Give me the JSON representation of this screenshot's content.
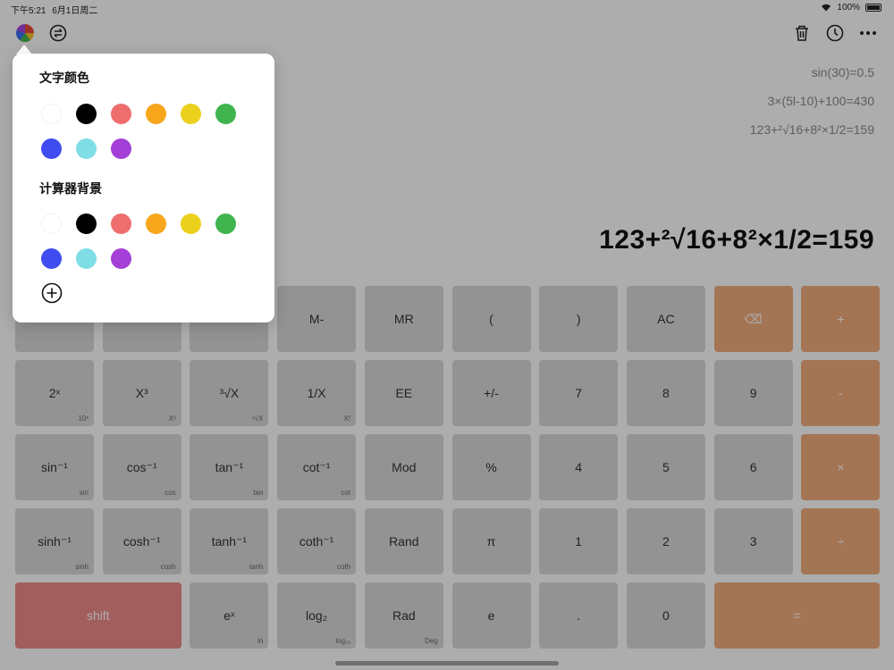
{
  "status_bar": {
    "time": "下午5:21",
    "date": "6月1日周二",
    "battery": "100%"
  },
  "toolbar": {
    "left_icons": [
      "color-wheel-icon",
      "swap-icon"
    ],
    "right_icons": [
      "trash-icon",
      "history-icon",
      "more-icon"
    ]
  },
  "history": [
    "sin(30)=0.5",
    "3×(5l-10)+100=430",
    "123+²√16+8²×1/2=159"
  ],
  "display": {
    "main": "123+²√16+8²×1/2=159"
  },
  "keypad": {
    "rows": [
      [
        {
          "label": "",
          "style": "normal"
        },
        {
          "label": "",
          "style": "normal"
        },
        {
          "label": "",
          "style": "normal"
        },
        {
          "label": "M-",
          "style": "normal"
        },
        {
          "label": "MR",
          "style": "normal"
        },
        {
          "label": "(",
          "style": "normal"
        },
        {
          "label": ")",
          "style": "normal"
        },
        {
          "label": "AC",
          "style": "normal"
        },
        {
          "label": "⌫",
          "style": "orange"
        },
        {
          "label": "+",
          "style": "orange"
        }
      ],
      [
        {
          "label": "2ˣ",
          "sub": "10ˣ"
        },
        {
          "label": "X³",
          "sub": "Xʸ"
        },
        {
          "label": "³√X",
          "sub": "ʸ√X"
        },
        {
          "label": "1/X",
          "sub": "X!"
        },
        {
          "label": "EE"
        },
        {
          "label": "+/-"
        },
        {
          "label": "7"
        },
        {
          "label": "8"
        },
        {
          "label": "9"
        },
        {
          "label": "-",
          "style": "orange"
        }
      ],
      [
        {
          "label": "sin⁻¹",
          "sub": "sin"
        },
        {
          "label": "cos⁻¹",
          "sub": "cos"
        },
        {
          "label": "tan⁻¹",
          "sub": "tan"
        },
        {
          "label": "cot⁻¹",
          "sub": "cot"
        },
        {
          "label": "Mod"
        },
        {
          "label": "%"
        },
        {
          "label": "4"
        },
        {
          "label": "5"
        },
        {
          "label": "6"
        },
        {
          "label": "×",
          "style": "orange"
        }
      ],
      [
        {
          "label": "sinh⁻¹",
          "sub": "sinh"
        },
        {
          "label": "cosh⁻¹",
          "sub": "cosh"
        },
        {
          "label": "tanh⁻¹",
          "sub": "tanh"
        },
        {
          "label": "coth⁻¹",
          "sub": "coth"
        },
        {
          "label": "Rand"
        },
        {
          "label": "π"
        },
        {
          "label": "1"
        },
        {
          "label": "2"
        },
        {
          "label": "3"
        },
        {
          "label": "÷",
          "style": "orange"
        }
      ],
      [
        {
          "label": "shift",
          "style": "red",
          "span": 2
        },
        {
          "label": "eˣ",
          "sub": "ln"
        },
        {
          "label": "log₂",
          "sub": "log₁₀"
        },
        {
          "label": "Rad",
          "sub": "Deg"
        },
        {
          "label": "e"
        },
        {
          "label": "."
        },
        {
          "label": "0"
        },
        {
          "label": "=",
          "style": "orange",
          "span": 2
        }
      ]
    ]
  },
  "popover": {
    "text_color": {
      "title": "文字颜色",
      "swatches": [
        "#ffffff",
        "#000000",
        "#ee6e6e",
        "#f7a61b",
        "#ecd01e",
        "#3fb44f",
        "#3e4cf0",
        "#7fdde6",
        "#a43fd7"
      ]
    },
    "background": {
      "title": "计算器背景",
      "swatches": [
        "#ffffff",
        "#000000",
        "#ee6e6e",
        "#f7a61b",
        "#ecd01e",
        "#3fb44f",
        "#3e4cf0",
        "#7fdde6",
        "#a43fd7"
      ]
    },
    "add_icon": "add-circle-icon"
  }
}
